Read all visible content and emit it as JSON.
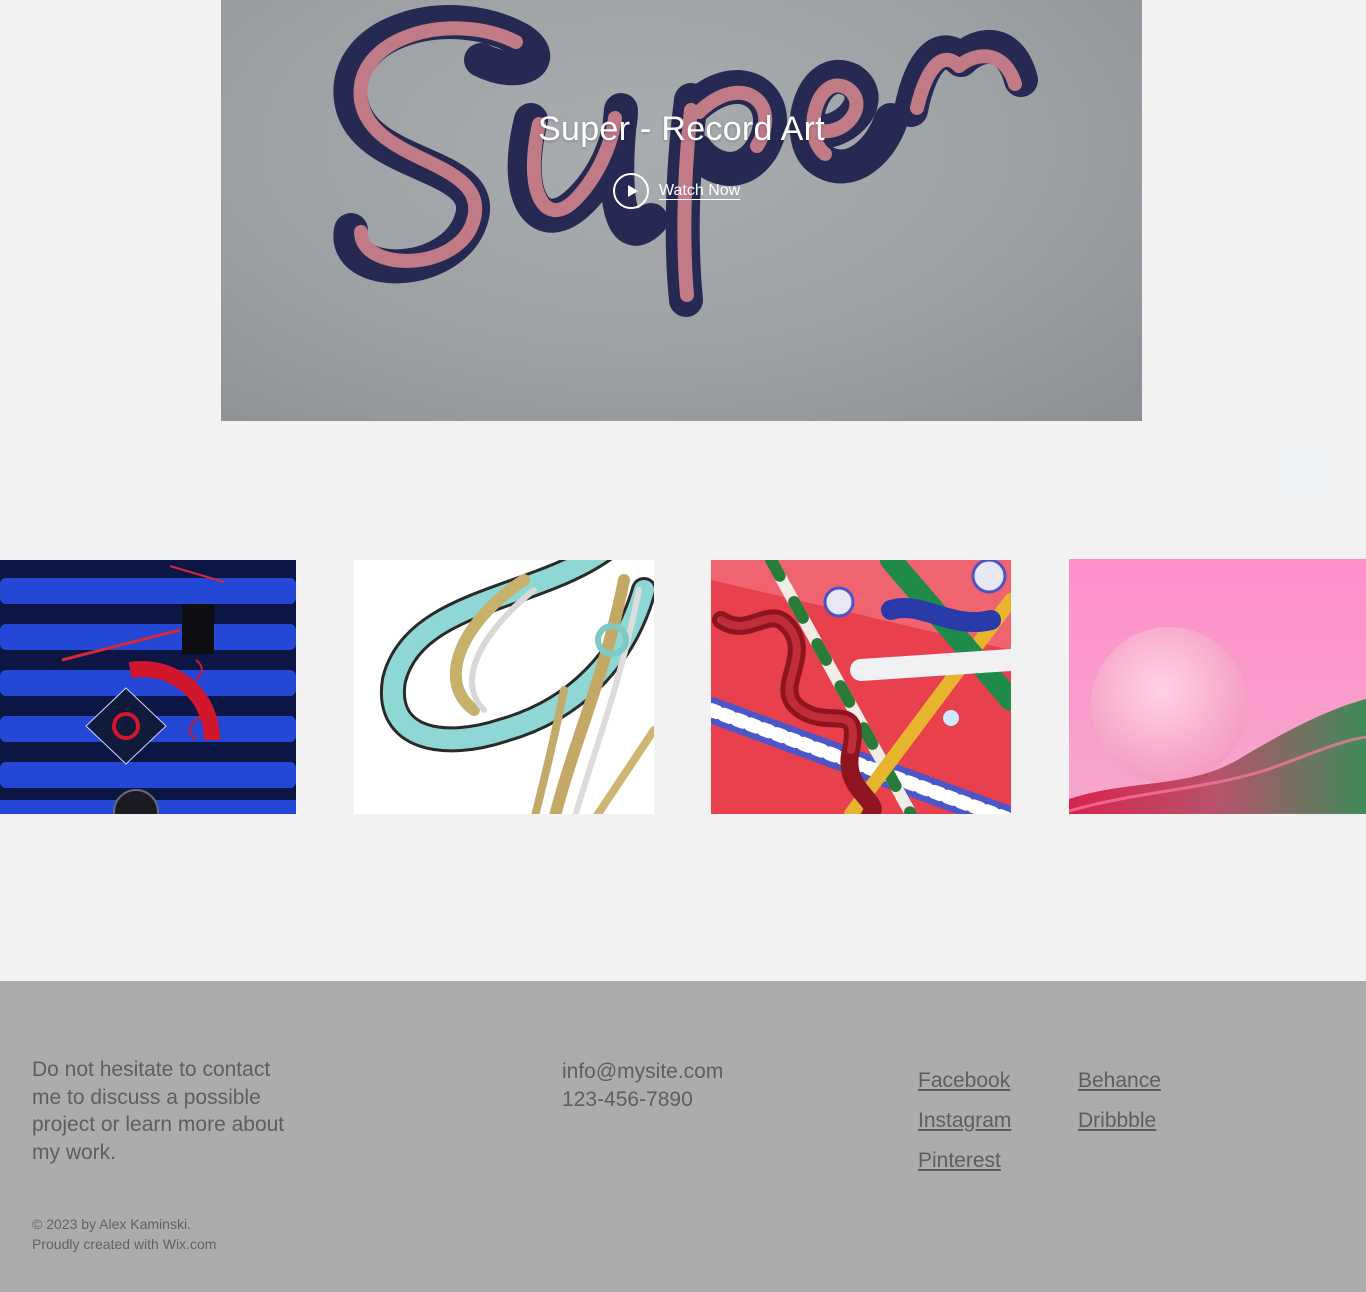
{
  "hero": {
    "title": "Super - Record Art",
    "watch_label": "Watch Now"
  },
  "gallery": {
    "items": [
      {
        "alt": "blue striped abstract composition"
      },
      {
        "alt": "chrome and teal rings"
      },
      {
        "alt": "red candy spiral composition"
      },
      {
        "alt": "pink sphere and wave"
      }
    ]
  },
  "footer": {
    "message": "Do not hesitate to contact me to discuss a possible project or learn more about my work.",
    "email": "info@mysite.com",
    "phone": "123-456-7890",
    "social_col1": [
      "Facebook",
      "Instagram",
      "Pinterest"
    ],
    "social_col2": [
      "Behance",
      "Dribbble"
    ],
    "copyright_line1": "© 2023 by Alex Kaminski.",
    "copyright_line2": "Proudly created with Wix.com"
  },
  "colors": {
    "page_bg": "#f2f2f2",
    "footer_bg": "#acacac",
    "footer_text": "#5e5e5e",
    "hero_bg": "#9da1a4"
  }
}
